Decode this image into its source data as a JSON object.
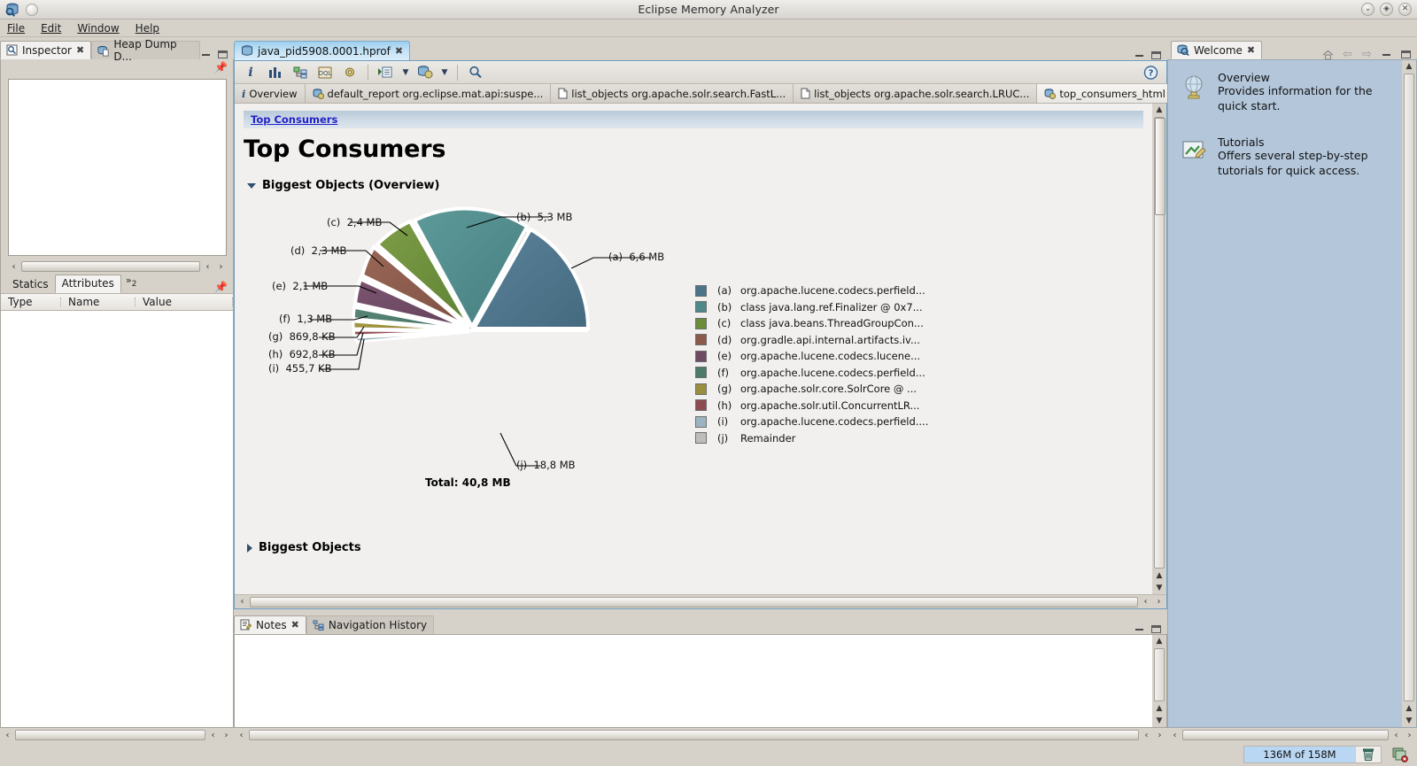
{
  "window": {
    "title": "Eclipse Memory Analyzer",
    "buttons": [
      "minimize",
      "maximize",
      "close"
    ],
    "app_icon": "database-search-icon"
  },
  "menubar": {
    "items": [
      "File",
      "Edit",
      "Window",
      "Help"
    ]
  },
  "inspector": {
    "tabs": [
      {
        "label": "Inspector",
        "icon": "inspector-icon",
        "active": true,
        "closable": true
      },
      {
        "label": "Heap Dump D...",
        "icon": "heap-dump-icon",
        "active": false,
        "closable": false
      }
    ],
    "sub_tabs": [
      {
        "label": "Statics",
        "active": false
      },
      {
        "label": "Attributes",
        "active": true
      }
    ],
    "more_tabs_indicator": "»",
    "more_tabs_count": "2",
    "table_headers": [
      "Type",
      "Name",
      "Value"
    ],
    "pin_icon": "pin-icon"
  },
  "editor": {
    "tab": {
      "label": "java_pid5908.0001.hprof",
      "icon": "heap-dump-icon",
      "closable": true
    },
    "toolbar": [
      {
        "name": "overview-info-icon",
        "glyph": "i"
      },
      {
        "name": "histogram-icon",
        "glyph": "bars"
      },
      {
        "name": "dominator-tree-icon",
        "glyph": "tree"
      },
      {
        "name": "oql-icon",
        "glyph": "OQL"
      },
      {
        "name": "settings-gear-icon",
        "glyph": "gear"
      },
      {
        "name": "run-expert-system-icon",
        "glyph": "run-list"
      },
      {
        "name": "open-query-browser-icon",
        "glyph": "heap-gear"
      },
      {
        "name": "search-icon",
        "glyph": "magnifier"
      }
    ],
    "help_icon": "help-icon",
    "report_tabs": [
      {
        "label": "Overview",
        "icon": "info-icon",
        "active": false
      },
      {
        "label": "default_report  org.eclipse.mat.api:suspe...",
        "icon": "report-icon",
        "active": false
      },
      {
        "label": "list_objects org.apache.solr.search.FastL...",
        "icon": "page-icon",
        "active": false
      },
      {
        "label": "list_objects org.apache.solr.search.LRUC...",
        "icon": "page-icon",
        "active": false
      },
      {
        "label": "top_consumers_html",
        "icon": "report-icon",
        "active": true
      }
    ]
  },
  "report": {
    "breadcrumb": "Top Consumers",
    "title": "Top Consumers",
    "sections": [
      {
        "label": "Biggest Objects (Overview)",
        "expanded": true
      },
      {
        "label": "Biggest Objects",
        "expanded": false
      }
    ],
    "total_label": "Total: 40,8 MB"
  },
  "chart_data": {
    "type": "pie",
    "title": "Biggest Objects (Overview)",
    "total": "40,8 MB",
    "unit_note": "values shown as displayed labels",
    "legend_position": "right",
    "slices": [
      {
        "key": "(a)",
        "label": "org.apache.lucene.codecs.perfield...",
        "value_label": "6,6 MB",
        "value_mb": 6.6,
        "color": "#4b7389"
      },
      {
        "key": "(b)",
        "label": "class java.lang.ref.Finalizer @ 0x7...",
        "value_label": "5,3 MB",
        "value_mb": 5.3,
        "color": "#4f8a8b"
      },
      {
        "key": "(c)",
        "label": "class java.beans.ThreadGroupCon...",
        "value_label": "2,4 MB",
        "value_mb": 2.4,
        "color": "#6b8c3b"
      },
      {
        "key": "(d)",
        "label": "org.gradle.api.internal.artifacts.iv...",
        "value_label": "2,3 MB",
        "value_mb": 2.3,
        "color": "#8b5a4a"
      },
      {
        "key": "(e)",
        "label": "org.apache.lucene.codecs.lucene...",
        "value_label": "2,1 MB",
        "value_mb": 2.1,
        "color": "#6e4a63"
      },
      {
        "key": "(f)",
        "label": "org.apache.lucene.codecs.perfield...",
        "value_label": "1,3 MB",
        "value_mb": 1.3,
        "color": "#4e7a6b"
      },
      {
        "key": "(g)",
        "label": "org.apache.solr.core.SolrCore @ ...",
        "value_label": "869,8 KB",
        "value_mb": 0.849,
        "color": "#9a8e3c"
      },
      {
        "key": "(h)",
        "label": "org.apache.solr.util.ConcurrentLR...",
        "value_label": "692,8 KB",
        "value_mb": 0.676,
        "color": "#8d4a4f"
      },
      {
        "key": "(i)",
        "label": "org.apache.lucene.codecs.perfield....",
        "value_label": "455,7 KB",
        "value_mb": 0.445,
        "color": "#9db4c0"
      },
      {
        "key": "(j)",
        "label": "Remainder",
        "value_label": "18,8 MB",
        "value_mb": 18.8,
        "color": "#bdbdbd"
      }
    ]
  },
  "bottom_panel": {
    "tabs": [
      {
        "label": "Notes",
        "icon": "notes-icon",
        "active": true,
        "closable": true
      },
      {
        "label": "Navigation History",
        "icon": "navigation-history-icon",
        "active": false,
        "closable": false
      }
    ]
  },
  "welcome": {
    "tab": {
      "label": "Welcome",
      "icon": "welcome-icon",
      "closable": true
    },
    "nav_icons": [
      "home-icon",
      "back-icon",
      "forward-icon"
    ],
    "items": [
      {
        "icon": "globe-icon",
        "title": "Overview",
        "desc": "Provides information for the quick start."
      },
      {
        "icon": "tutorials-icon",
        "title": "Tutorials",
        "desc": "Offers several step-by-step tutorials for quick access."
      }
    ]
  },
  "statusbar": {
    "heap_text": "136M of 158M",
    "trash_icon": "trash-icon",
    "right_icon": "close-perspective-icon"
  },
  "colors": {
    "accent_tab": "#9fd0ef",
    "welcome_bg": "#b3c6da",
    "breadcrumb_bg": "#b8c9d9",
    "link": "#2222c8"
  }
}
